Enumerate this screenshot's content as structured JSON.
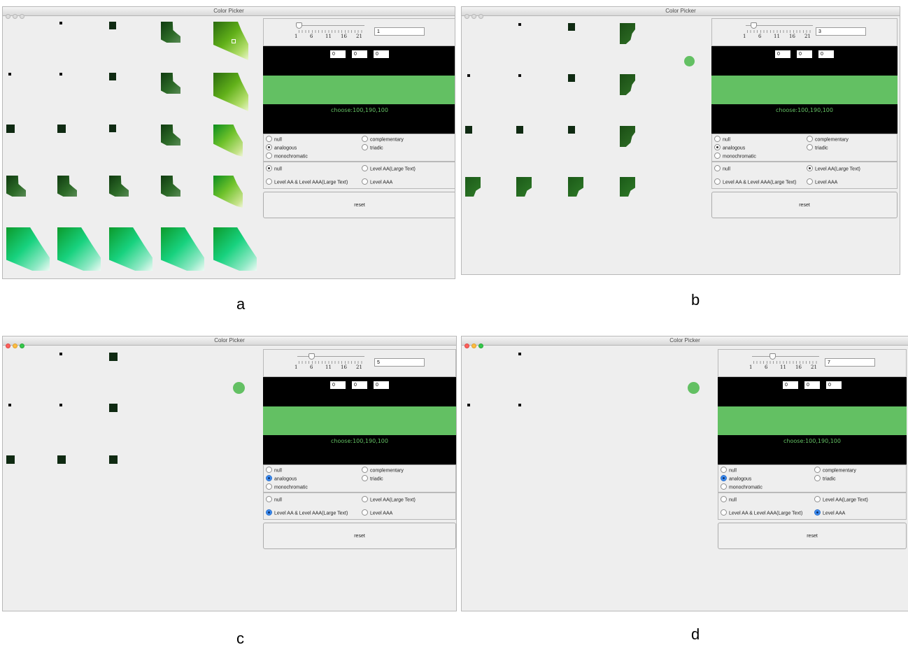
{
  "accent_green": "#63c063",
  "chosen_dot_color": "#63c063",
  "windows": [
    {
      "id": "a",
      "caption": "a",
      "title": "Color Picker",
      "slider_value": "1",
      "rgb": [
        "0",
        "0",
        "0"
      ],
      "choose": "choose:100,190,100",
      "radio_scheme": {
        "null": "null",
        "complementary": "complementary",
        "analogous": "analogous",
        "triadic": "triadic",
        "monochromatic": "monochromatic",
        "selected": "analogous"
      },
      "radio_level": {
        "null": "null",
        "aa_large": "Level AA(Large Text)",
        "aa_aaa_large": "Level AA & Level AAA(Large Text)",
        "aaa": "Level AAA",
        "selected": "null"
      },
      "reset": "reset",
      "tick_labels": [
        "1",
        "6",
        "11",
        "16",
        "21"
      ],
      "active": false
    },
    {
      "id": "b",
      "caption": "b",
      "title": "Color Picker",
      "slider_value": "3",
      "rgb": [
        "0",
        "0",
        "0"
      ],
      "choose": "choose:100,190,100",
      "radio_scheme": {
        "null": "null",
        "complementary": "complementary",
        "analogous": "analogous",
        "triadic": "triadic",
        "monochromatic": "monochromatic",
        "selected": "analogous"
      },
      "radio_level": {
        "null": "null",
        "aa_large": "Level AA(Large Text)",
        "aa_aaa_large": "Level AA & Level AAA(Large Text)",
        "aaa": "Level AAA",
        "selected": "aa_large"
      },
      "reset": "reset",
      "tick_labels": [
        "1",
        "6",
        "11",
        "16",
        "21"
      ],
      "active": false
    },
    {
      "id": "c",
      "caption": "c",
      "title": "Color Picker",
      "slider_value": "5",
      "rgb": [
        "0",
        "0",
        "0"
      ],
      "choose": "choose:100,190,100",
      "radio_scheme": {
        "null": "null",
        "complementary": "complementary",
        "analogous": "analogous",
        "triadic": "triadic",
        "monochromatic": "monochromatic",
        "selected": "analogous"
      },
      "radio_level": {
        "null": "null",
        "aa_large": "Level AA(Large Text)",
        "aa_aaa_large": "Level AA & Level AAA(Large Text)",
        "aaa": "Level AAA",
        "selected": "aa_aaa_large"
      },
      "reset": "reset",
      "tick_labels": [
        "1",
        "6",
        "11",
        "16",
        "21"
      ],
      "active": true
    },
    {
      "id": "d",
      "caption": "d",
      "title": "Color Picker",
      "slider_value": "7",
      "rgb": [
        "0",
        "0",
        "0"
      ],
      "choose": "choose:100,190,100",
      "radio_scheme": {
        "null": "null",
        "complementary": "complementary",
        "analogous": "analogous",
        "triadic": "triadic",
        "monochromatic": "monochromatic",
        "selected": "analogous"
      },
      "radio_level": {
        "null": "null",
        "aa_large": "Level AA(Large Text)",
        "aa_aaa_large": "Level AA & Level AAA(Large Text)",
        "aaa": "Level AAA",
        "selected": "aaa"
      },
      "reset": "reset",
      "tick_labels": [
        "1",
        "6",
        "11",
        "16",
        "21"
      ],
      "active": true
    }
  ]
}
